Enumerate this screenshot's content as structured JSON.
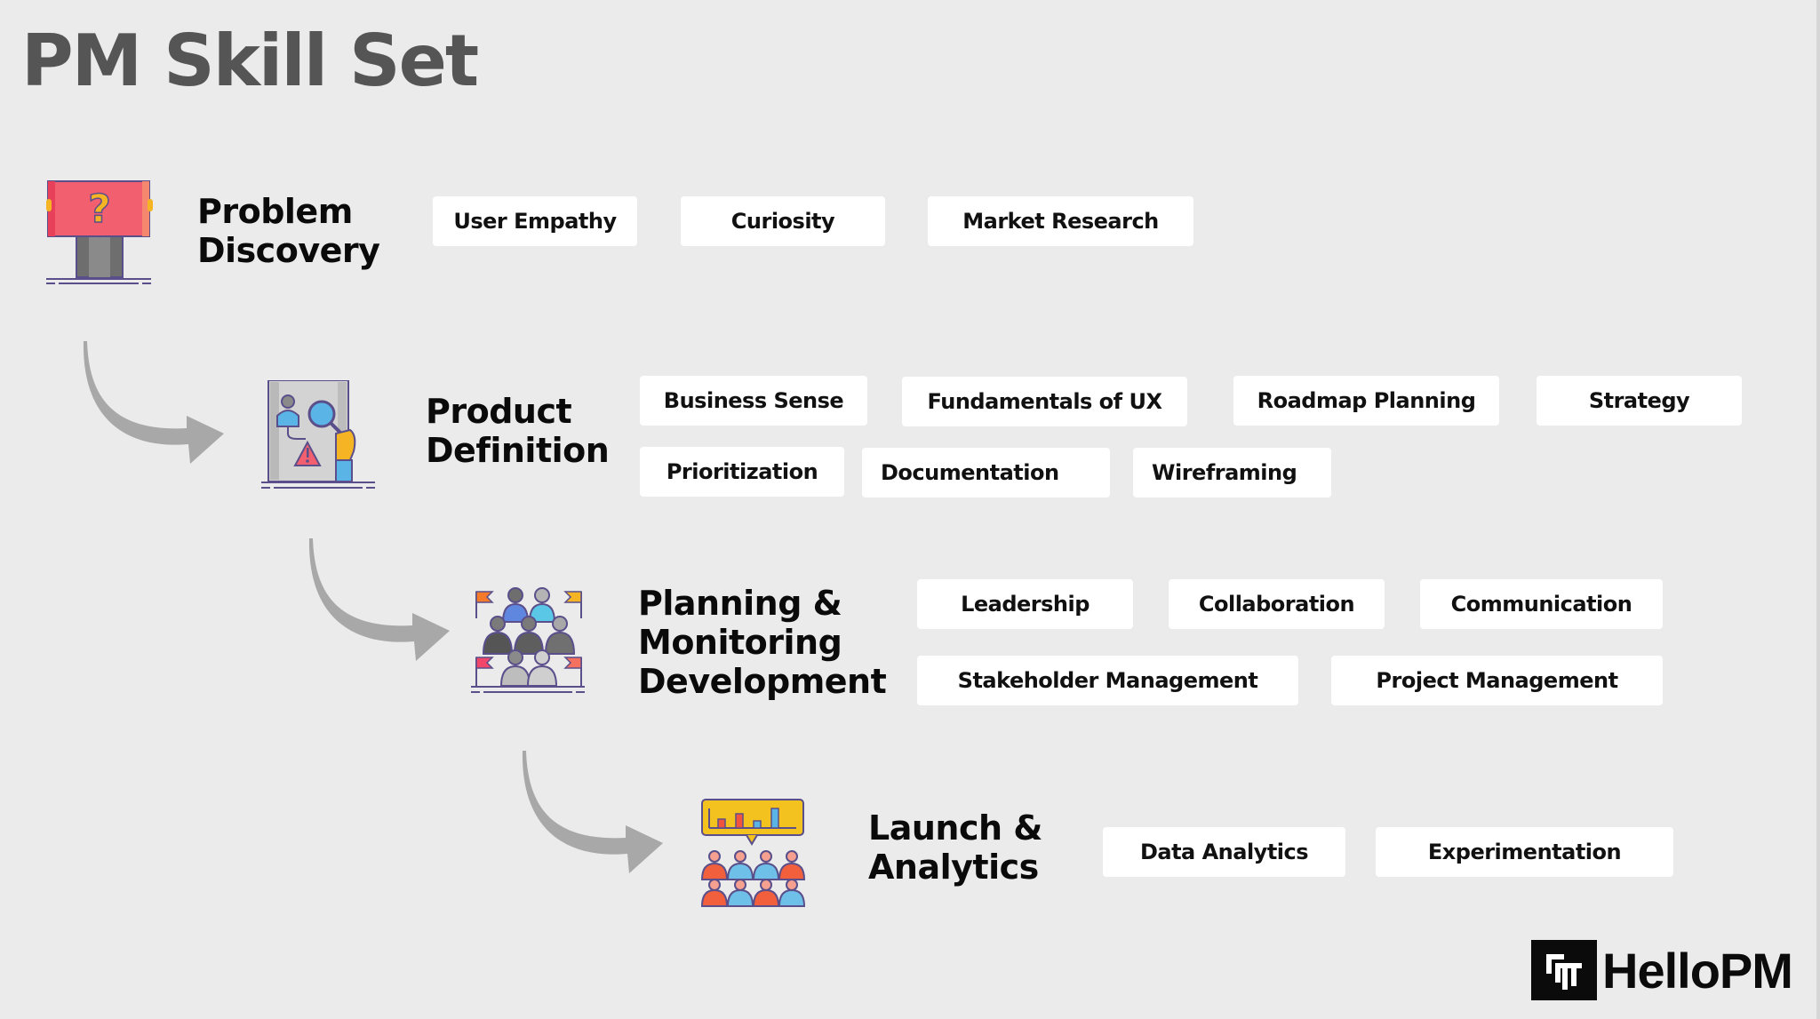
{
  "title": "PM Skill Set",
  "stages": [
    {
      "label_lines": [
        "Problem",
        "Discovery"
      ],
      "icon": "question-box-person-icon",
      "skills": [
        "User Empathy",
        "Curiosity",
        "Market Research"
      ]
    },
    {
      "label_lines": [
        "Product",
        "Definition"
      ],
      "icon": "document-search-warning-icon",
      "skills": [
        "Business Sense",
        "Fundamentals of UX",
        "Roadmap Planning",
        "Strategy",
        "Prioritization",
        "Documentation",
        "Wireframing"
      ]
    },
    {
      "label_lines": [
        "Planning &",
        "Monitoring",
        "Development"
      ],
      "icon": "team-flags-icon",
      "skills": [
        "Leadership",
        "Collaboration",
        "Communication",
        "Stakeholder Management",
        "Project Management"
      ]
    },
    {
      "label_lines": [
        "Launch &",
        "Analytics"
      ],
      "icon": "team-chart-presentation-icon",
      "skills": [
        "Data Analytics",
        "Experimentation"
      ]
    }
  ],
  "logo": {
    "text": "HelloPM",
    "mark": "PM"
  },
  "colors": {
    "background": "#ebebeb",
    "title": "#555555",
    "arrow": "#a8a8a8",
    "chip": "#ffffff"
  }
}
